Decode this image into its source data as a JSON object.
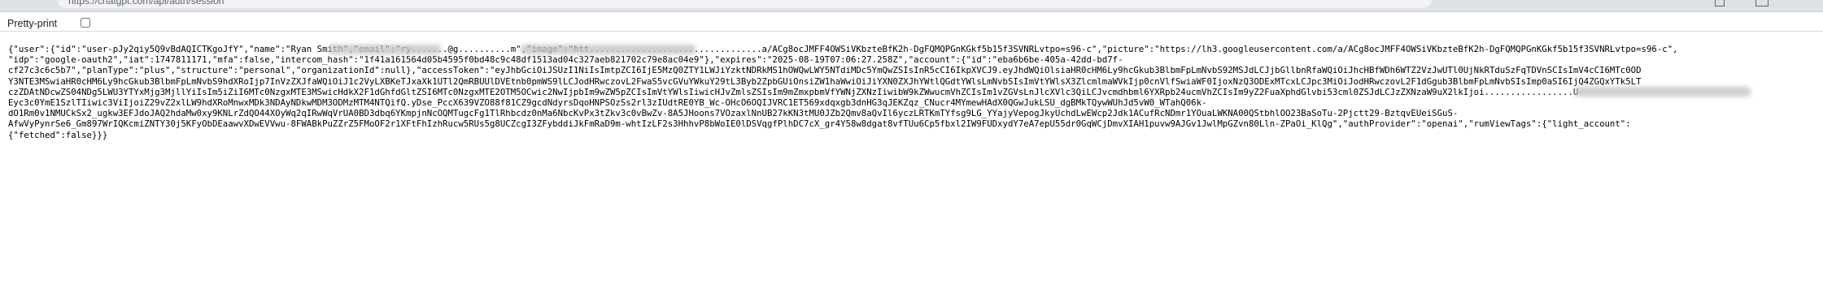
{
  "browser": {
    "address_text": "https://chatgpt.com/api/auth/session",
    "tab_controls": [
      "restore-icon",
      "maximize-icon"
    ]
  },
  "toolbar": {
    "pretty_print_label": "Pretty-print",
    "pretty_print_checked": false
  },
  "json_lines": [
    "{\"user\":{\"id\":\"user-pJy2qiy5Q9vBdAQICTKgoJfY\",\"name\":\"Ryan Smith\",\"email\":\"ry.......@g..........m\",\"image\":\"htt.................................a/ACg8ocJMFF4OWSiVKbzteBfK2h-DgFQMQPGnKGkf5b15f3SVNRLvtpo=s96-c\",\"picture\":\"https://lh3.googleusercontent.com/a/ACg8ocJMFF4OWSiVKbzteBfK2h-DgFQMQPGnKGkf5b15f3SVNRLvtpo=s96-c\",",
    "\"idp\":\"google-oauth2\",\"iat\":1747811171,\"mfa\":false,\"intercom_hash\":\"1f41a161564d05b4595f0bd48c9c48df1513ad04c327aeb821702c79e8ac04e9\"},\"expires\":\"2025-08-19T07:06:27.258Z\",\"account\":{\"id\":\"eba6b6be-405a-42dd-bd7f-",
    "cf27c3c6c5b7\",\"planType\":\"plus\",\"structure\":\"personal\",\"organizationId\":null},\"accessToken\":\"eyJhbGciOiJSUzI1NiIsImtpZCI6IjE5MzQ0ZTY1LWJiYzktNDRkMS1hOWQwLWY5NTdiMDc5YmQwZSIsInR5cCI6IkpXVCJ9.eyJhdWQiOlsiaHR0cHM6Ly9hcGkub3BlbmFpLmNvbS92MSJdLCJjbGllbnRfaWQiOiJhcHBfWDh6WTZ2VzJwUTl0UjNkRTduSzFqTDVnSCIsImV4cCI6MTc0OD",
    "Y3NTE3MSwiaHR0cHM6Ly9hcGkub3BlbmFpLmNvbS9hdXRoIjp7InVzZXJfaWQiOiJ1c2VyLXBKeTJxaXk1UTl2QmRBUUlDVEtnb0pmWS9lLCJodHRwczovL2FwaS5vcGVuYWkuY29tL3Byb2ZpbGUiOnsiZW1haWwiOiJiYXN0ZXJhYWtlQGdtYWlsLmNvbSIsImVtYWlsX3ZlcmlmaWVkIjp0cnVlfSwiaWF0IjoxNzQ3ODExMTcxLCJpc3MiOiJodHRwczovL2F1dGgub3BlbmFpLmNvbSIsImp0aSI6IjQ4ZGQxYTk5LT",
    "czZDAtNDcwZS04NDg5LWU3YTYxMjg3MjllYiIsIm5iZiI6MTc0NzgxMTE3MSwicHdkX2F1dGhfdGltZSI6MTc0NzgxMTE2OTM5OCwic2NwIjpbIm9wZW5pZCIsImVtYWlsIiwicHJvZmlsZSIsIm9mZmxpbmVfYWNjZXNzIiwibW9kZWwucmVhZCIsIm1vZGVsLnJlcXVlc3QiLCJvcmdhbml6YXRpb24ucmVhZCIsIm9yZ2FuaXphdGlvbi53cml0ZSJdLCJzZXNzaW9uX2lkIjoi.................U",
    "Eyc3c0YmE1SzlTIiwic3ViIjoiZ29vZ2xlLW9hdXRoMnwxMDk3NDAyNDkwMDM3ODMzMTM4NTQifQ.yDse_PccX639VZO88f81CZ9gcdNdyrsDqoHNPSOzSs2rl3zIUdtRE0YB_Wc-OHcO6OQIJVRC1ET569xdqxgb3dnHG3qJEKZqz_CNucr4MYmewHAdX0QGwJukLSU_dgBMkTQywWUhJd5vW0_WTahQ06k-",
    "dO1Rm0v1NMUCkSx2_ugkw3EFJdoJAQ2hdaMw0xy9KNLrZdQO44XOyWq2qIRwWqVrUA0BD3dbq6YKmpjnNcOQMTugcFg1TlRhbcdz0nMa6NbcKvPx3tZkv3c0vBwZv-8A5JHoons7VOzaxlNnUB27kKN3tMU0JZb2Qmv8aQvIl6yczLRTKmTYfsg9LG_YYajyVepogJkyUchdLwEWcp2Jdk1ACufRcNDmr1YOuaLWKNA00QStbhlOO23BaSoTu-2Pjctt29-BztqvEUeiSGuS-",
    "AfwVyPynrSe6_Gm897WrIQKcmiZNTY30j5KFyObDEaawvXDwEVVwu-8FWABkPuZZrZ5FMoOF2r1XFtFhIzhRucw5RUs5g8UCZcgI3ZFybddiJkFmRaD9m-whtIzLF2s3HhhvP8bWoIE0lDSVqgfPlhDC7cX_gr4Y58w8dgat8vfTUu6Cp5fbxl2IW9FUDxydY7eA7epU55dr0GqWCjDmvXIAH1puvw9AJGv1JwlMpGZvn80Lln-ZPaOi_KlQg\",\"authProvider\":\"openai\",\"rumViewTags\":{\"light_account\":",
    "{\"fetched\":false}}}"
  ]
}
